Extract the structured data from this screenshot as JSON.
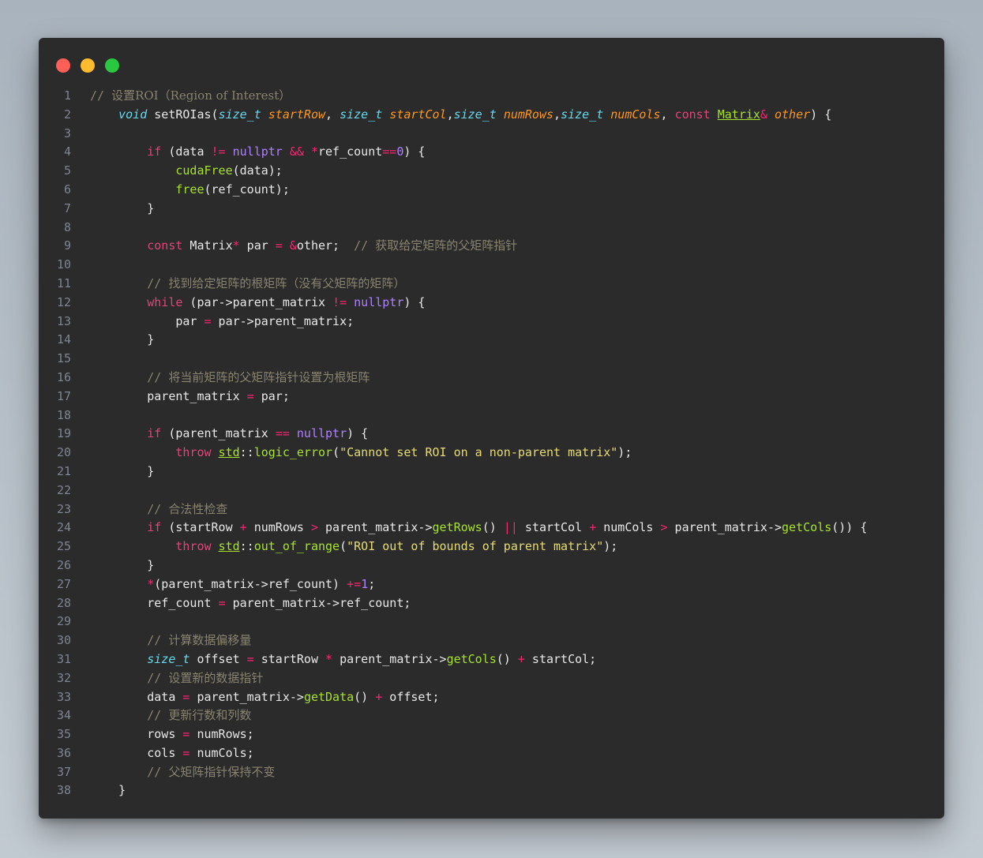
{
  "window": {
    "controls": [
      {
        "name": "close-button",
        "color": "#ff5f57"
      },
      {
        "name": "minimize-button",
        "color": "#febc2e"
      },
      {
        "name": "maximize-button",
        "color": "#28c840"
      }
    ]
  },
  "code": {
    "line_numbers": [
      "1",
      "2",
      "3",
      "4",
      "5",
      "6",
      "7",
      "8",
      "9",
      "10",
      "11",
      "12",
      "13",
      "14",
      "15",
      "16",
      "17",
      "18",
      "19",
      "20",
      "21",
      "22",
      "23",
      "24",
      "25",
      "26",
      "27",
      "28",
      "29",
      "30",
      "31",
      "32",
      "33",
      "34",
      "35",
      "36",
      "37",
      "38"
    ],
    "lines": [
      [
        {
          "t": "// ",
          "c": "cmm"
        },
        {
          "t": "设置ROI（Region of Interest）",
          "c": "cm"
        }
      ],
      [
        {
          "t": "    ",
          "c": "pl"
        },
        {
          "t": "void",
          "c": "ty"
        },
        {
          "t": " setROIas(",
          "c": "pl"
        },
        {
          "t": "size_t",
          "c": "ty"
        },
        {
          "t": " ",
          "c": "pl"
        },
        {
          "t": "startRow",
          "c": "pa"
        },
        {
          "t": ", ",
          "c": "pl"
        },
        {
          "t": "size_t",
          "c": "ty"
        },
        {
          "t": " ",
          "c": "pl"
        },
        {
          "t": "startCol",
          "c": "pa"
        },
        {
          "t": ",",
          "c": "pl"
        },
        {
          "t": "size_t",
          "c": "ty"
        },
        {
          "t": " ",
          "c": "pl"
        },
        {
          "t": "numRows",
          "c": "pa"
        },
        {
          "t": ",",
          "c": "pl"
        },
        {
          "t": "size_t",
          "c": "ty"
        },
        {
          "t": " ",
          "c": "pl"
        },
        {
          "t": "numCols",
          "c": "pa"
        },
        {
          "t": ", ",
          "c": "pl"
        },
        {
          "t": "const",
          "c": "kw"
        },
        {
          "t": " ",
          "c": "pl"
        },
        {
          "t": "Matrix",
          "c": "cl"
        },
        {
          "t": "&",
          "c": "op"
        },
        {
          "t": " ",
          "c": "pl"
        },
        {
          "t": "other",
          "c": "pa"
        },
        {
          "t": ") {",
          "c": "pl"
        }
      ],
      [],
      [
        {
          "t": "        ",
          "c": "pl"
        },
        {
          "t": "if",
          "c": "kw"
        },
        {
          "t": " (data ",
          "c": "pl"
        },
        {
          "t": "!=",
          "c": "op"
        },
        {
          "t": " ",
          "c": "pl"
        },
        {
          "t": "nullptr",
          "c": "nl"
        },
        {
          "t": " ",
          "c": "pl"
        },
        {
          "t": "&&",
          "c": "op"
        },
        {
          "t": " ",
          "c": "pl"
        },
        {
          "t": "*",
          "c": "op"
        },
        {
          "t": "ref_count",
          "c": "pl"
        },
        {
          "t": "==",
          "c": "op"
        },
        {
          "t": "0",
          "c": "nl"
        },
        {
          "t": ") {",
          "c": "pl"
        }
      ],
      [
        {
          "t": "            ",
          "c": "pl"
        },
        {
          "t": "cudaFree",
          "c": "fn"
        },
        {
          "t": "(data);",
          "c": "pl"
        }
      ],
      [
        {
          "t": "            ",
          "c": "pl"
        },
        {
          "t": "free",
          "c": "fn"
        },
        {
          "t": "(ref_count);",
          "c": "pl"
        }
      ],
      [
        {
          "t": "        }",
          "c": "pl"
        }
      ],
      [],
      [
        {
          "t": "        ",
          "c": "pl"
        },
        {
          "t": "const",
          "c": "kw"
        },
        {
          "t": " Matrix",
          "c": "pl"
        },
        {
          "t": "*",
          "c": "op"
        },
        {
          "t": " par ",
          "c": "pl"
        },
        {
          "t": "=",
          "c": "op"
        },
        {
          "t": " ",
          "c": "pl"
        },
        {
          "t": "&",
          "c": "op"
        },
        {
          "t": "other;  ",
          "c": "pl"
        },
        {
          "t": "// ",
          "c": "cmm"
        },
        {
          "t": "获取给定矩阵的父矩阵指针",
          "c": "cm"
        }
      ],
      [],
      [
        {
          "t": "        ",
          "c": "pl"
        },
        {
          "t": "// ",
          "c": "cmm"
        },
        {
          "t": "找到给定矩阵的根矩阵（没有父矩阵的矩阵）",
          "c": "cm"
        }
      ],
      [
        {
          "t": "        ",
          "c": "pl"
        },
        {
          "t": "while",
          "c": "kw"
        },
        {
          "t": " (par->parent_matrix ",
          "c": "pl"
        },
        {
          "t": "!=",
          "c": "op"
        },
        {
          "t": " ",
          "c": "pl"
        },
        {
          "t": "nullptr",
          "c": "nl"
        },
        {
          "t": ") {",
          "c": "pl"
        }
      ],
      [
        {
          "t": "            par ",
          "c": "pl"
        },
        {
          "t": "=",
          "c": "op"
        },
        {
          "t": " par->parent_matrix;",
          "c": "pl"
        }
      ],
      [
        {
          "t": "        }",
          "c": "pl"
        }
      ],
      [],
      [
        {
          "t": "        ",
          "c": "pl"
        },
        {
          "t": "// ",
          "c": "cmm"
        },
        {
          "t": "将当前矩阵的父矩阵指针设置为根矩阵",
          "c": "cm"
        }
      ],
      [
        {
          "t": "        parent_matrix ",
          "c": "pl"
        },
        {
          "t": "=",
          "c": "op"
        },
        {
          "t": " par;",
          "c": "pl"
        }
      ],
      [],
      [
        {
          "t": "        ",
          "c": "pl"
        },
        {
          "t": "if",
          "c": "kw"
        },
        {
          "t": " (parent_matrix ",
          "c": "pl"
        },
        {
          "t": "==",
          "c": "op"
        },
        {
          "t": " ",
          "c": "pl"
        },
        {
          "t": "nullptr",
          "c": "nl"
        },
        {
          "t": ") {",
          "c": "pl"
        }
      ],
      [
        {
          "t": "            ",
          "c": "pl"
        },
        {
          "t": "throw",
          "c": "kw"
        },
        {
          "t": " ",
          "c": "pl"
        },
        {
          "t": "std",
          "c": "ns"
        },
        {
          "t": "::",
          "c": "pl"
        },
        {
          "t": "logic_error",
          "c": "fn"
        },
        {
          "t": "(",
          "c": "pl"
        },
        {
          "t": "\"Cannot set ROI on a non-parent matrix\"",
          "c": "st"
        },
        {
          "t": ");",
          "c": "pl"
        }
      ],
      [
        {
          "t": "        }",
          "c": "pl"
        }
      ],
      [],
      [
        {
          "t": "        ",
          "c": "pl"
        },
        {
          "t": "// ",
          "c": "cmm"
        },
        {
          "t": "合法性检查",
          "c": "cm"
        }
      ],
      [
        {
          "t": "        ",
          "c": "pl"
        },
        {
          "t": "if",
          "c": "kw"
        },
        {
          "t": " (startRow ",
          "c": "pl"
        },
        {
          "t": "+",
          "c": "op"
        },
        {
          "t": " numRows ",
          "c": "pl"
        },
        {
          "t": ">",
          "c": "op"
        },
        {
          "t": " parent_matrix->",
          "c": "pl"
        },
        {
          "t": "getRows",
          "c": "fn"
        },
        {
          "t": "() ",
          "c": "pl"
        },
        {
          "t": "||",
          "c": "op"
        },
        {
          "t": " startCol ",
          "c": "pl"
        },
        {
          "t": "+",
          "c": "op"
        },
        {
          "t": " numCols ",
          "c": "pl"
        },
        {
          "t": ">",
          "c": "op"
        },
        {
          "t": " parent_matrix->",
          "c": "pl"
        },
        {
          "t": "getCols",
          "c": "fn"
        },
        {
          "t": "()) {",
          "c": "pl"
        }
      ],
      [
        {
          "t": "            ",
          "c": "pl"
        },
        {
          "t": "throw",
          "c": "kw"
        },
        {
          "t": " ",
          "c": "pl"
        },
        {
          "t": "std",
          "c": "ns"
        },
        {
          "t": "::",
          "c": "pl"
        },
        {
          "t": "out_of_range",
          "c": "fn"
        },
        {
          "t": "(",
          "c": "pl"
        },
        {
          "t": "\"ROI out of bounds of parent matrix\"",
          "c": "st"
        },
        {
          "t": ");",
          "c": "pl"
        }
      ],
      [
        {
          "t": "        }",
          "c": "pl"
        }
      ],
      [
        {
          "t": "        ",
          "c": "pl"
        },
        {
          "t": "*",
          "c": "op"
        },
        {
          "t": "(parent_matrix->ref_count) ",
          "c": "pl"
        },
        {
          "t": "+=",
          "c": "op"
        },
        {
          "t": "1",
          "c": "nl"
        },
        {
          "t": ";",
          "c": "pl"
        }
      ],
      [
        {
          "t": "        ref_count ",
          "c": "pl"
        },
        {
          "t": "=",
          "c": "op"
        },
        {
          "t": " parent_matrix->ref_count;",
          "c": "pl"
        }
      ],
      [],
      [
        {
          "t": "        ",
          "c": "pl"
        },
        {
          "t": "// ",
          "c": "cmm"
        },
        {
          "t": "计算数据偏移量",
          "c": "cm"
        }
      ],
      [
        {
          "t": "        ",
          "c": "pl"
        },
        {
          "t": "size_t",
          "c": "ty"
        },
        {
          "t": " offset ",
          "c": "pl"
        },
        {
          "t": "=",
          "c": "op"
        },
        {
          "t": " startRow ",
          "c": "pl"
        },
        {
          "t": "*",
          "c": "op"
        },
        {
          "t": " parent_matrix->",
          "c": "pl"
        },
        {
          "t": "getCols",
          "c": "fn"
        },
        {
          "t": "() ",
          "c": "pl"
        },
        {
          "t": "+",
          "c": "op"
        },
        {
          "t": " startCol;",
          "c": "pl"
        }
      ],
      [
        {
          "t": "        ",
          "c": "pl"
        },
        {
          "t": "// ",
          "c": "cmm"
        },
        {
          "t": "设置新的数据指针",
          "c": "cm"
        }
      ],
      [
        {
          "t": "        data ",
          "c": "pl"
        },
        {
          "t": "=",
          "c": "op"
        },
        {
          "t": " parent_matrix->",
          "c": "pl"
        },
        {
          "t": "getData",
          "c": "fn"
        },
        {
          "t": "() ",
          "c": "pl"
        },
        {
          "t": "+",
          "c": "op"
        },
        {
          "t": " offset;",
          "c": "pl"
        }
      ],
      [
        {
          "t": "        ",
          "c": "pl"
        },
        {
          "t": "// ",
          "c": "cmm"
        },
        {
          "t": "更新行数和列数",
          "c": "cm"
        }
      ],
      [
        {
          "t": "        rows ",
          "c": "pl"
        },
        {
          "t": "=",
          "c": "op"
        },
        {
          "t": " numRows;",
          "c": "pl"
        }
      ],
      [
        {
          "t": "        cols ",
          "c": "pl"
        },
        {
          "t": "=",
          "c": "op"
        },
        {
          "t": " numCols;",
          "c": "pl"
        }
      ],
      [
        {
          "t": "        ",
          "c": "pl"
        },
        {
          "t": "// ",
          "c": "cmm"
        },
        {
          "t": "父矩阵指针保持不变",
          "c": "cm"
        }
      ],
      [
        {
          "t": "    }",
          "c": "pl"
        }
      ]
    ]
  }
}
